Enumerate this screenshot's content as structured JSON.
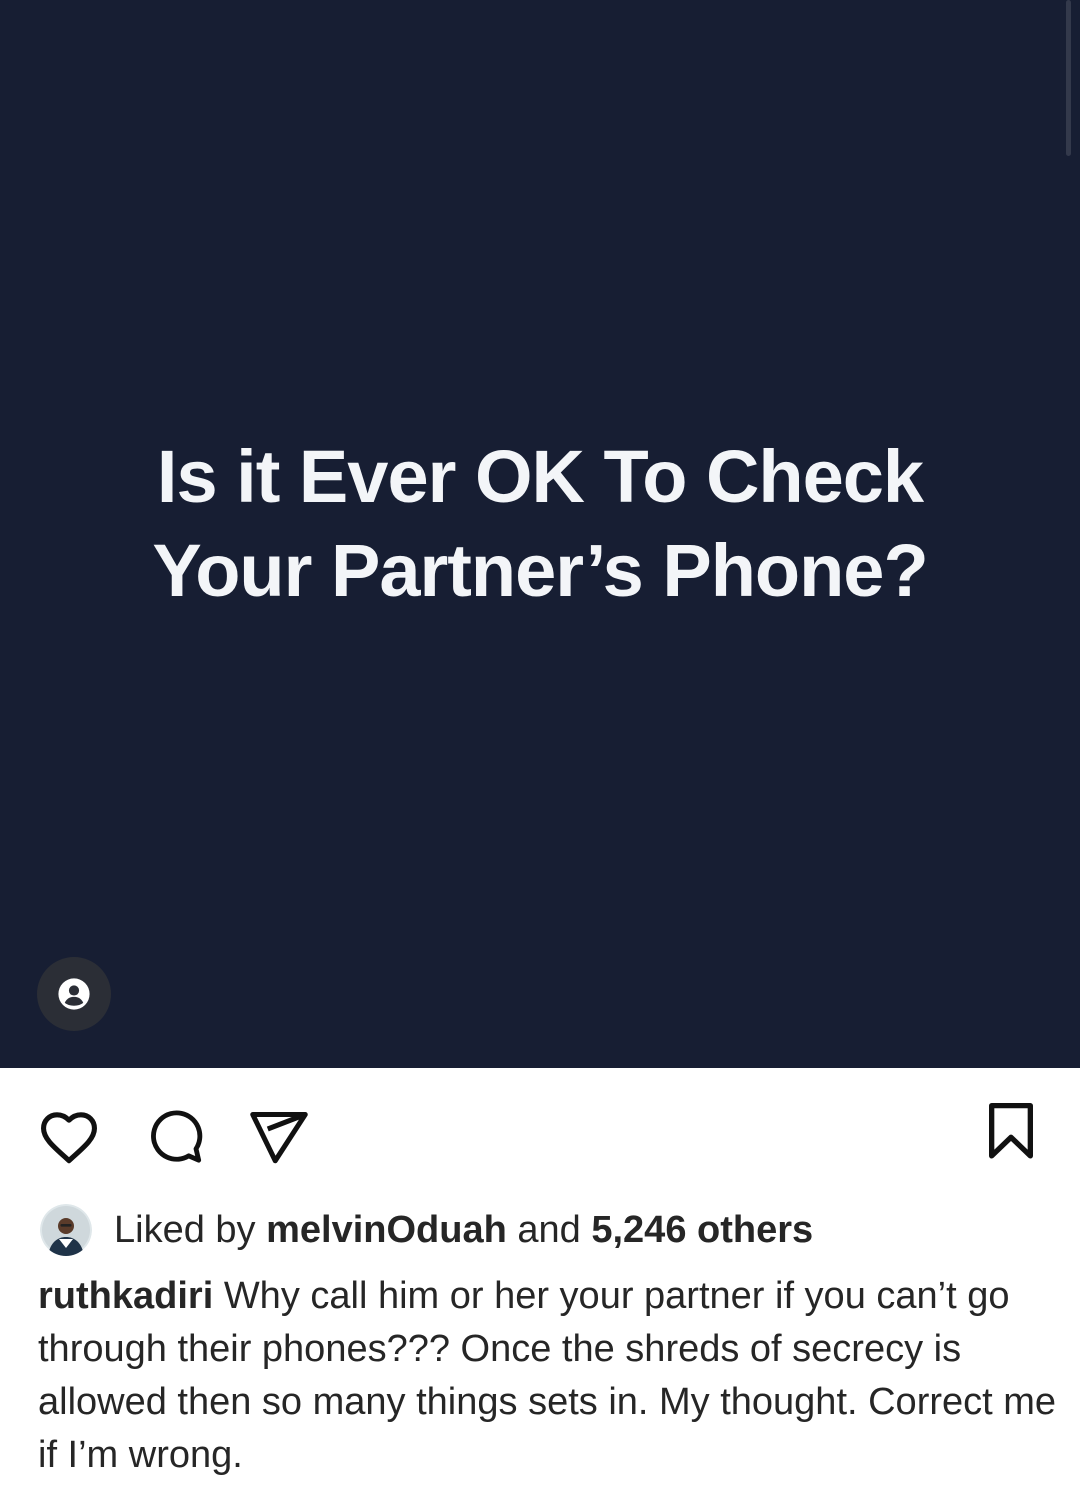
{
  "post": {
    "image_text": {
      "line1": "Is it Ever OK To Check",
      "line2": "Your Partner’s Phone?"
    },
    "background_color": "#171e33",
    "tag_icon": "person-tag-icon"
  },
  "actions": {
    "like_icon": "heart-icon",
    "comment_icon": "comment-icon",
    "share_icon": "send-icon",
    "save_icon": "bookmark-icon"
  },
  "likes": {
    "prefix": "Liked by",
    "user": "melvinOduah",
    "joiner": "and",
    "others": "5,246 others"
  },
  "caption": {
    "username": "ruthkadiri",
    "text": "Why call him or her your partner if you can’t go through their phones??? Once the shreds of secrecy is allowed then so many things sets in. My thought. Correct me if I’m wrong."
  }
}
